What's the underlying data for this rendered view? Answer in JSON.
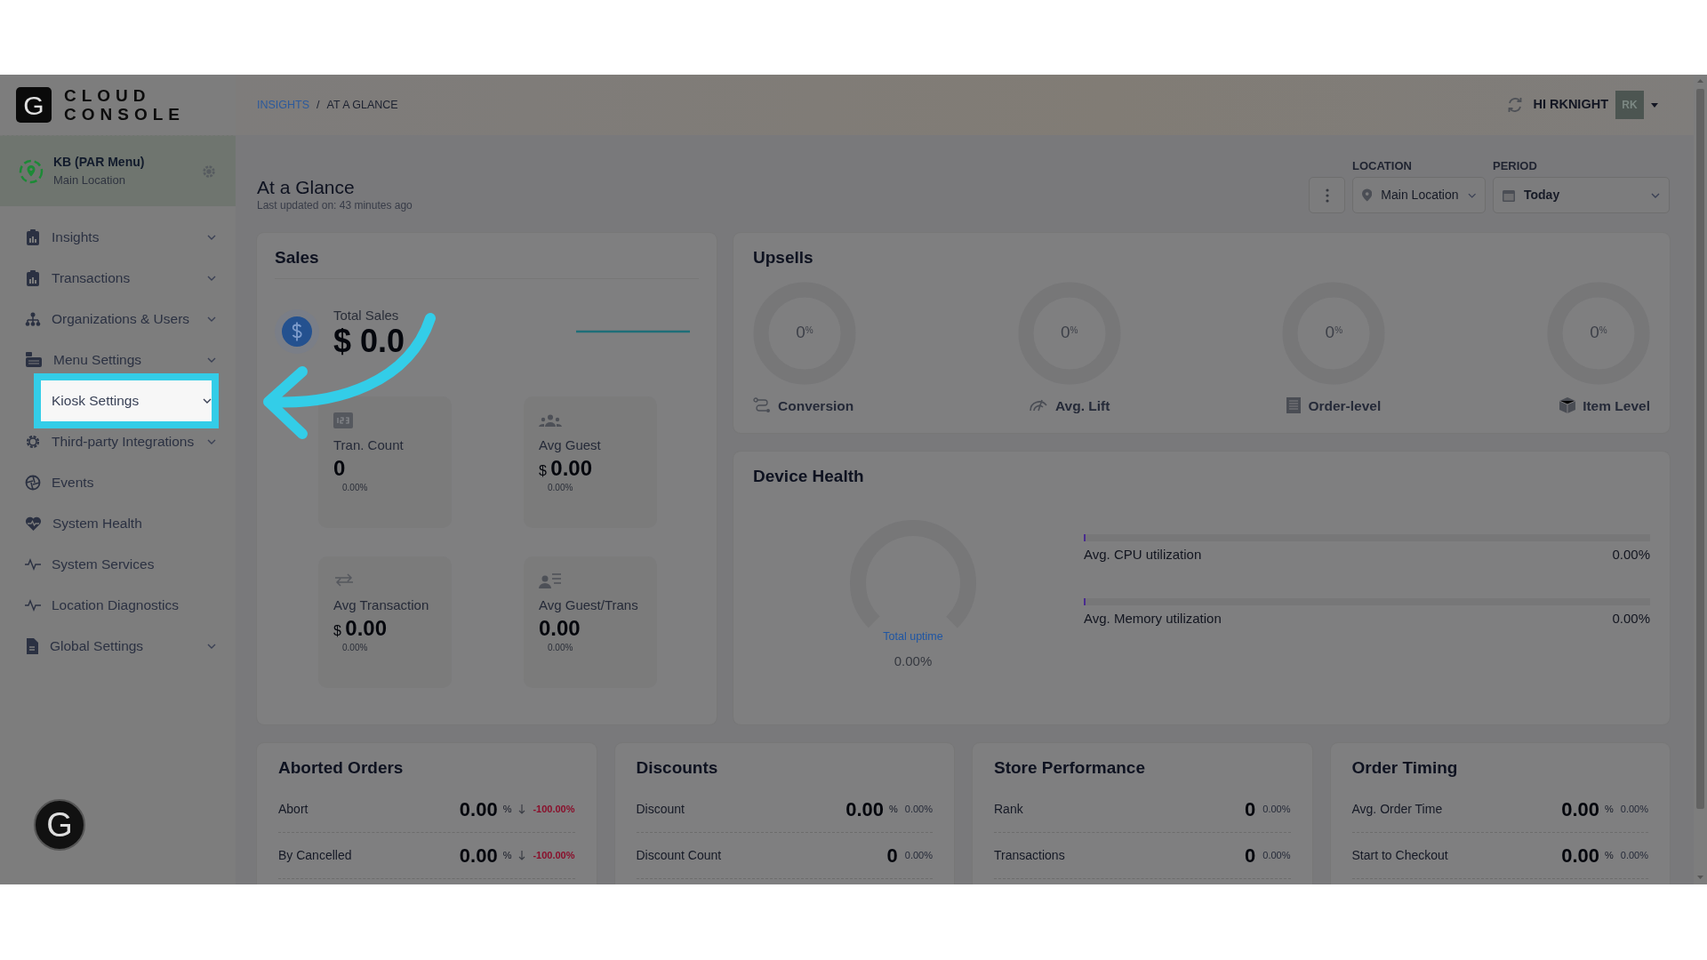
{
  "logo": {
    "letter": "G",
    "line1": "CLOUD",
    "line2": "CONSOLE",
    "badge_letter": "G"
  },
  "location_block": {
    "name": "KB (PAR Menu)",
    "subtitle": "Main Location"
  },
  "sidebar": {
    "items": [
      {
        "label": "Insights",
        "expandable": true,
        "highlighted": false
      },
      {
        "label": "Transactions",
        "expandable": true,
        "highlighted": false
      },
      {
        "label": "Organizations & Users",
        "expandable": true,
        "highlighted": false
      },
      {
        "label": "Menu Settings",
        "expandable": true,
        "highlighted": false
      },
      {
        "label": "Kiosk Settings",
        "expandable": true,
        "highlighted": true
      },
      {
        "label": "Third-party Integrations",
        "expandable": true,
        "highlighted": false
      },
      {
        "label": "Events",
        "expandable": false,
        "highlighted": false
      },
      {
        "label": "System Health",
        "expandable": false,
        "highlighted": false
      },
      {
        "label": "System Services",
        "expandable": false,
        "highlighted": false
      },
      {
        "label": "Location Diagnostics",
        "expandable": false,
        "highlighted": false
      },
      {
        "label": "Global Settings",
        "expandable": true,
        "highlighted": false
      }
    ]
  },
  "breadcrumb": {
    "separator": "/",
    "items": [
      {
        "label": "INSIGHTS",
        "link": true
      },
      {
        "label": "AT A GLANCE",
        "link": false
      }
    ]
  },
  "user": {
    "greeting": "HI RKNIGHT",
    "initials": "RK"
  },
  "page": {
    "title": "At a Glance",
    "updated": "Last updated on: 43 minutes ago"
  },
  "filters": {
    "location": {
      "label": "LOCATION",
      "value": "Main Location"
    },
    "period": {
      "label": "PERIOD",
      "value": "Today"
    }
  },
  "sales": {
    "title": "Sales",
    "total_label": "Total Sales",
    "total_value": "$ 0.0",
    "tiles": [
      {
        "label": "Tran. Count",
        "value": "0",
        "change": "0.00%"
      },
      {
        "label": "Avg Guest",
        "prefix": "$",
        "value": "0.00",
        "change": "0.00%"
      },
      {
        "label": "Avg Transaction",
        "prefix": "$",
        "value": "0.00",
        "change": "0.00%"
      },
      {
        "label": "Avg Guest/Trans",
        "value": "0.00",
        "change": "0.00%"
      }
    ]
  },
  "upsells": {
    "title": "Upsells",
    "items": [
      {
        "value": "0$^{%}$",
        "label": "Conversion",
        "level": 0
      },
      {
        "value": "0$^{%}$",
        "label": "Avg. Lift",
        "level": 0
      },
      {
        "value": "0$^{%}$",
        "label": "Order-level",
        "level": 0
      },
      {
        "value": "0$^{%}$",
        "label": "Item Level",
        "level": 0
      }
    ]
  },
  "device_health": {
    "title": "Device Health",
    "uptime": {
      "label": "Total uptime",
      "value": "0.00%",
      "level": 0
    },
    "meters": [
      {
        "label": "Avg. CPU utilization",
        "reading": "0.00%",
        "level": 0
      },
      {
        "label": "Avg. Memory utilization",
        "reading": "0.00%",
        "level": 0
      }
    ]
  },
  "panels": [
    {
      "title": "Aborted Orders",
      "rows": [
        {
          "label": "Abort",
          "value": "0.00",
          "unit": "%",
          "change": "-100.00%",
          "falling": true
        },
        {
          "label": "By Cancelled",
          "value": "0.00",
          "unit": "%",
          "change": "-100.00%",
          "falling": true
        }
      ]
    },
    {
      "title": "Discounts",
      "rows": [
        {
          "label": "Discount",
          "value": "0.00",
          "unit": "%",
          "change": "0.00%",
          "falling": false
        },
        {
          "label": "Discount Count",
          "value": "0",
          "change": "0.00%",
          "falling": false
        }
      ]
    },
    {
      "title": "Store Performance",
      "rows": [
        {
          "label": "Rank",
          "value": "0",
          "change": "0.00%",
          "falling": false
        },
        {
          "label": "Transactions",
          "value": "0",
          "change": "0.00%",
          "falling": false
        }
      ]
    },
    {
      "title": "Order Timing",
      "rows": [
        {
          "label": "Avg. Order Time",
          "value": "0.00",
          "unit": "%",
          "change": "0.00%",
          "falling": false
        },
        {
          "label": "Start to Checkout",
          "value": "0.00",
          "unit": "%",
          "change": "0.00%",
          "falling": false
        }
      ]
    }
  ]
}
